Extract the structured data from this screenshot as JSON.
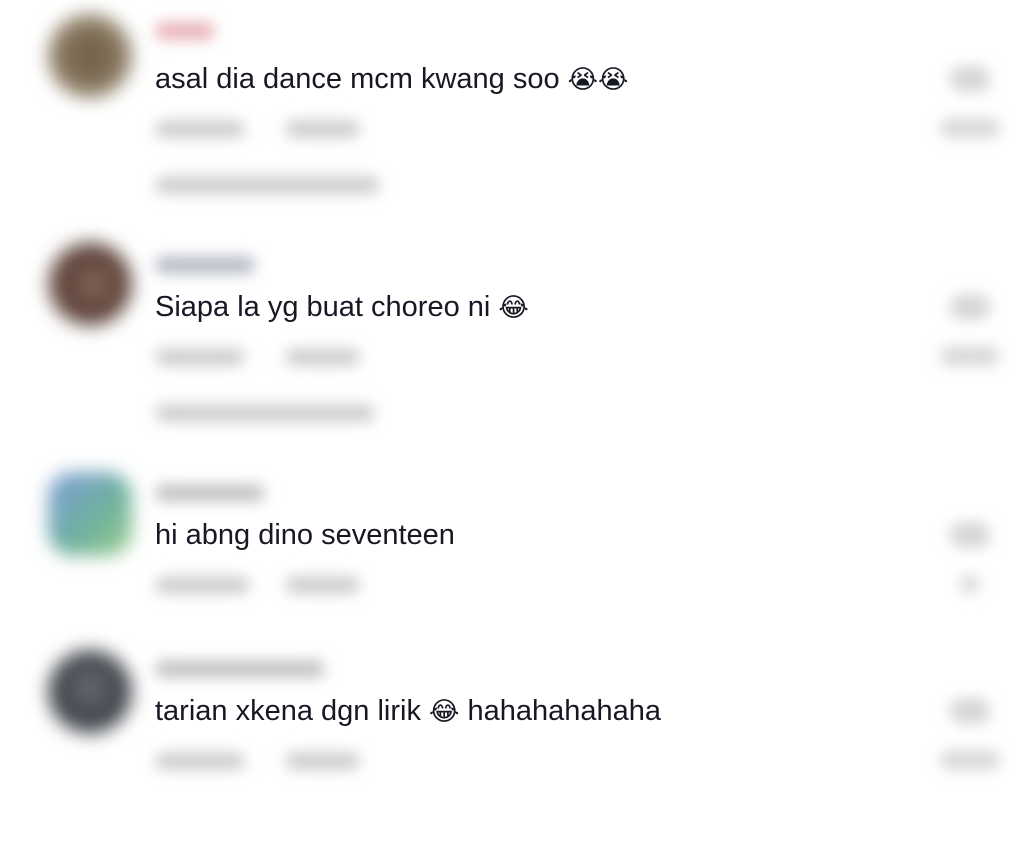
{
  "comments": [
    {
      "text": "asal dia dance mcm kwang soo",
      "emoji": "😭😭",
      "after": ""
    },
    {
      "text": "Siapa la yg buat choreo ni",
      "emoji": "😂",
      "after": ""
    },
    {
      "text": "hi abng dino seventeen",
      "emoji": "",
      "after": ""
    },
    {
      "text": "tarian xkena dgn lirik",
      "emoji": "😂",
      "after": "hahahahahaha"
    }
  ],
  "icons": {
    "like": "heart-icon",
    "avatar": "user-avatar"
  },
  "colors": {
    "text": "#161823",
    "blurred_meta": "#c8c8c8",
    "background": "#ffffff"
  }
}
